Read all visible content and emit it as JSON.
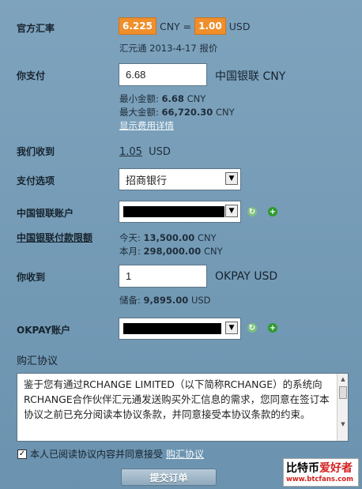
{
  "rate": {
    "label": "官方汇率",
    "cny_value": "6.225",
    "cny_unit": "CNY =",
    "usd_value": "1.00",
    "usd_unit": "USD",
    "source": "汇元通 2013-4-17 报价"
  },
  "pay": {
    "label": "你支付",
    "value": "6.68",
    "currency": "中国银联 CNY",
    "min_label": "最小金额:",
    "min_value": "6.68",
    "min_unit": "CNY",
    "max_label": "最大金额:",
    "max_value": "66,720.30",
    "max_unit": "CNY",
    "fee_link": "显示费用详情"
  },
  "receive_us": {
    "label": "我们收到",
    "value": "1.05",
    "unit": "USD"
  },
  "payment_option": {
    "label": "支付选项",
    "selected": "招商银行"
  },
  "unionpay_account": {
    "label": "中国银联账户"
  },
  "unionpay_limit": {
    "label": "中国银联付款限额",
    "today_label": "今天:",
    "today_value": "13,500.00",
    "today_unit": "CNY",
    "month_label": "本月:",
    "month_value": "298,000.00",
    "month_unit": "CNY"
  },
  "receive_you": {
    "label": "你收到",
    "value": "1",
    "currency": "OKPAY USD",
    "reserve_label": "储备:",
    "reserve_value": "9,895.00",
    "reserve_unit": "USD"
  },
  "okpay_account": {
    "label": "OKPAY账户"
  },
  "agreement": {
    "title": "购汇协议",
    "text": "鉴于您有通过RCHANGE LIMITED（以下简称RCHANGE）的系统向RCHANGE合作伙伴汇元通发送购买外汇信息的需求，您同意在签订本协议之前已充分阅读本协议条款，并同意接受本协议条款的约束。",
    "checkbox_label": "本人已阅读协议内容并同意接受",
    "link": "购汇协议"
  },
  "submit": {
    "label": "提交订单"
  },
  "watermark": {
    "text1": "比特币",
    "text2": "爱好者",
    "url": "www.btcfans.com"
  },
  "colors": {
    "badge": "#ef8f2c",
    "background": "#6f96b1",
    "add_icon": "#3aa03a",
    "refresh_icon": "#6cae6c",
    "watermark_red": "#d32020"
  }
}
